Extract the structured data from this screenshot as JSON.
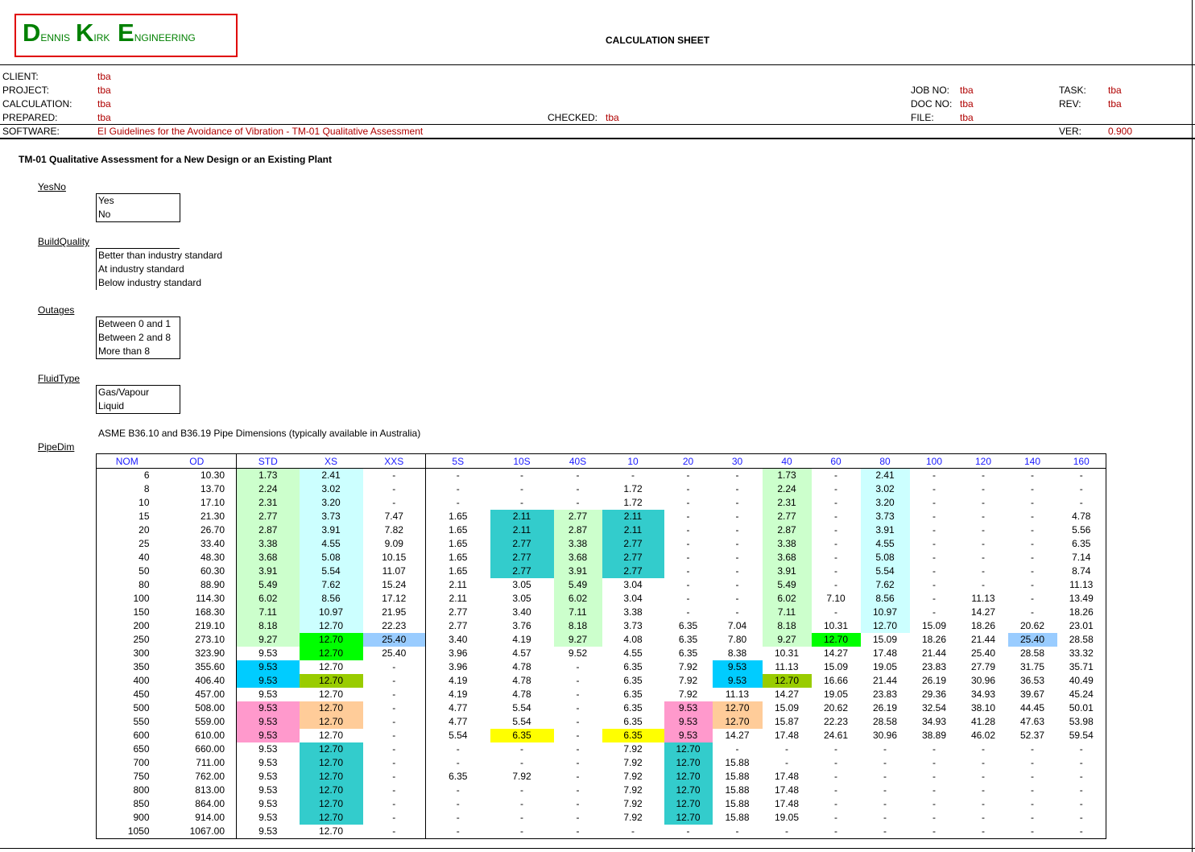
{
  "logo": {
    "d_big": "D",
    "d_rest": "ENNIS",
    "k_big": "K",
    "k_rest": "IRK",
    "e_big": "E",
    "e_rest": "NGINEERING"
  },
  "title": "CALCULATION SHEET",
  "header": {
    "client_label": "CLIENT:",
    "client": "tba",
    "project_label": "PROJECT:",
    "project": "tba",
    "calculation_label": "CALCULATION:",
    "calculation": "tba",
    "prepared_label": "PREPARED:",
    "prepared": "tba",
    "software_label": "SOFTWARE:",
    "software": "EI Guidelines for the Avoidance of Vibration - TM-01 Qualitative Assessment",
    "checked_label": "CHECKED:",
    "checked": "tba",
    "jobno_label": "JOB NO:",
    "jobno": "tba",
    "docno_label": "DOC NO:",
    "docno": "tba",
    "file_label": "FILE:",
    "file": "tba",
    "task_label": "TASK:",
    "task": "tba",
    "rev_label": "REV:",
    "rev": "tba",
    "ver_label": "VER:",
    "ver": "0.900"
  },
  "section_title": "TM-01 Qualitative Assessment for a New Design or an Existing Plant",
  "lists": {
    "yesno": {
      "name": "YesNo",
      "items": [
        "Yes",
        "No"
      ]
    },
    "buildquality": {
      "name": "BuildQuality",
      "items": [
        "Better than industry standard",
        "At industry standard",
        "Below industry standard"
      ]
    },
    "outages": {
      "name": "Outages",
      "items": [
        "Between 0 and 1",
        "Between 2 and 8",
        "More than 8"
      ]
    },
    "fluidtype": {
      "name": "FluidType",
      "items": [
        "Gas/Vapour",
        "Liquid"
      ]
    }
  },
  "pipedim": {
    "name": "PipeDim",
    "caption": "ASME B36.10 and B36.19 Pipe Dimensions (typically available in Australia)",
    "columns": [
      "NOM",
      "OD",
      "STD",
      "XS",
      "XXS",
      "5S",
      "10S",
      "40S",
      "10",
      "20",
      "30",
      "40",
      "60",
      "80",
      "100",
      "120",
      "140",
      "160"
    ],
    "rows": [
      [
        "6",
        "10.30",
        "1.73",
        "2.41",
        "-",
        "-",
        "-",
        "-",
        "-",
        "-",
        "-",
        "1.73",
        "-",
        "2.41",
        "-",
        "-",
        "-",
        "-"
      ],
      [
        "8",
        "13.70",
        "2.24",
        "3.02",
        "-",
        "-",
        "-",
        "-",
        "1.72",
        "-",
        "-",
        "2.24",
        "-",
        "3.02",
        "-",
        "-",
        "-",
        "-"
      ],
      [
        "10",
        "17.10",
        "2.31",
        "3.20",
        "-",
        "-",
        "-",
        "-",
        "1.72",
        "-",
        "-",
        "2.31",
        "-",
        "3.20",
        "-",
        "-",
        "-",
        "-"
      ],
      [
        "15",
        "21.30",
        "2.77",
        "3.73",
        "7.47",
        "1.65",
        "2.11",
        "2.77",
        "2.11",
        "-",
        "-",
        "2.77",
        "-",
        "3.73",
        "-",
        "-",
        "-",
        "4.78"
      ],
      [
        "20",
        "26.70",
        "2.87",
        "3.91",
        "7.82",
        "1.65",
        "2.11",
        "2.87",
        "2.11",
        "-",
        "-",
        "2.87",
        "-",
        "3.91",
        "-",
        "-",
        "-",
        "5.56"
      ],
      [
        "25",
        "33.40",
        "3.38",
        "4.55",
        "9.09",
        "1.65",
        "2.77",
        "3.38",
        "2.77",
        "-",
        "-",
        "3.38",
        "-",
        "4.55",
        "-",
        "-",
        "-",
        "6.35"
      ],
      [
        "40",
        "48.30",
        "3.68",
        "5.08",
        "10.15",
        "1.65",
        "2.77",
        "3.68",
        "2.77",
        "-",
        "-",
        "3.68",
        "-",
        "5.08",
        "-",
        "-",
        "-",
        "7.14"
      ],
      [
        "50",
        "60.30",
        "3.91",
        "5.54",
        "11.07",
        "1.65",
        "2.77",
        "3.91",
        "2.77",
        "-",
        "-",
        "3.91",
        "-",
        "5.54",
        "-",
        "-",
        "-",
        "8.74"
      ],
      [
        "80",
        "88.90",
        "5.49",
        "7.62",
        "15.24",
        "2.11",
        "3.05",
        "5.49",
        "3.04",
        "-",
        "-",
        "5.49",
        "-",
        "7.62",
        "-",
        "-",
        "-",
        "11.13"
      ],
      [
        "100",
        "114.30",
        "6.02",
        "8.56",
        "17.12",
        "2.11",
        "3.05",
        "6.02",
        "3.04",
        "-",
        "-",
        "6.02",
        "7.10",
        "8.56",
        "-",
        "11.13",
        "-",
        "13.49"
      ],
      [
        "150",
        "168.30",
        "7.11",
        "10.97",
        "21.95",
        "2.77",
        "3.40",
        "7.11",
        "3.38",
        "-",
        "-",
        "7.11",
        "-",
        "10.97",
        "-",
        "14.27",
        "-",
        "18.26"
      ],
      [
        "200",
        "219.10",
        "8.18",
        "12.70",
        "22.23",
        "2.77",
        "3.76",
        "8.18",
        "3.73",
        "6.35",
        "7.04",
        "8.18",
        "10.31",
        "12.70",
        "15.09",
        "18.26",
        "20.62",
        "23.01"
      ],
      [
        "250",
        "273.10",
        "9.27",
        "12.70",
        "25.40",
        "3.40",
        "4.19",
        "9.27",
        "4.08",
        "6.35",
        "7.80",
        "9.27",
        "12.70",
        "15.09",
        "18.26",
        "21.44",
        "25.40",
        "28.58"
      ],
      [
        "300",
        "323.90",
        "9.53",
        "12.70",
        "25.40",
        "3.96",
        "4.57",
        "9.52",
        "4.55",
        "6.35",
        "8.38",
        "10.31",
        "14.27",
        "17.48",
        "21.44",
        "25.40",
        "28.58",
        "33.32"
      ],
      [
        "350",
        "355.60",
        "9.53",
        "12.70",
        "-",
        "3.96",
        "4.78",
        "-",
        "6.35",
        "7.92",
        "9.53",
        "11.13",
        "15.09",
        "19.05",
        "23.83",
        "27.79",
        "31.75",
        "35.71"
      ],
      [
        "400",
        "406.40",
        "9.53",
        "12.70",
        "-",
        "4.19",
        "4.78",
        "-",
        "6.35",
        "7.92",
        "9.53",
        "12.70",
        "16.66",
        "21.44",
        "26.19",
        "30.96",
        "36.53",
        "40.49"
      ],
      [
        "450",
        "457.00",
        "9.53",
        "12.70",
        "-",
        "4.19",
        "4.78",
        "-",
        "6.35",
        "7.92",
        "11.13",
        "14.27",
        "19.05",
        "23.83",
        "29.36",
        "34.93",
        "39.67",
        "45.24"
      ],
      [
        "500",
        "508.00",
        "9.53",
        "12.70",
        "-",
        "4.77",
        "5.54",
        "-",
        "6.35",
        "9.53",
        "12.70",
        "15.09",
        "20.62",
        "26.19",
        "32.54",
        "38.10",
        "44.45",
        "50.01"
      ],
      [
        "550",
        "559.00",
        "9.53",
        "12.70",
        "-",
        "4.77",
        "5.54",
        "-",
        "6.35",
        "9.53",
        "12.70",
        "15.87",
        "22.23",
        "28.58",
        "34.93",
        "41.28",
        "47.63",
        "53.98"
      ],
      [
        "600",
        "610.00",
        "9.53",
        "12.70",
        "-",
        "5.54",
        "6.35",
        "-",
        "6.35",
        "9.53",
        "14.27",
        "17.48",
        "24.61",
        "30.96",
        "38.89",
        "46.02",
        "52.37",
        "59.54"
      ],
      [
        "650",
        "660.00",
        "9.53",
        "12.70",
        "-",
        "-",
        "-",
        "-",
        "7.92",
        "12.70",
        "-",
        "-",
        "-",
        "-",
        "-",
        "-",
        "-",
        "-"
      ],
      [
        "700",
        "711.00",
        "9.53",
        "12.70",
        "-",
        "-",
        "-",
        "-",
        "7.92",
        "12.70",
        "15.88",
        "-",
        "-",
        "-",
        "-",
        "-",
        "-",
        "-"
      ],
      [
        "750",
        "762.00",
        "9.53",
        "12.70",
        "-",
        "6.35",
        "7.92",
        "-",
        "7.92",
        "12.70",
        "15.88",
        "17.48",
        "-",
        "-",
        "-",
        "-",
        "-",
        "-"
      ],
      [
        "800",
        "813.00",
        "9.53",
        "12.70",
        "-",
        "-",
        "-",
        "-",
        "7.92",
        "12.70",
        "15.88",
        "17.48",
        "-",
        "-",
        "-",
        "-",
        "-",
        "-"
      ],
      [
        "850",
        "864.00",
        "9.53",
        "12.70",
        "-",
        "-",
        "-",
        "-",
        "7.92",
        "12.70",
        "15.88",
        "17.48",
        "-",
        "-",
        "-",
        "-",
        "-",
        "-"
      ],
      [
        "900",
        "914.00",
        "9.53",
        "12.70",
        "-",
        "-",
        "-",
        "-",
        "7.92",
        "12.70",
        "15.88",
        "19.05",
        "-",
        "-",
        "-",
        "-",
        "-",
        "-"
      ],
      [
        "1050",
        "1067.00",
        "9.53",
        "12.70",
        "-",
        "-",
        "-",
        "-",
        "-",
        "-",
        "-",
        "-",
        "-",
        "-",
        "-",
        "-",
        "-",
        "-"
      ]
    ]
  },
  "colors": {
    "logo_green": "#008000",
    "logo_border": "#e00000",
    "value_red": "#b00000",
    "header_blue": "#1a1aff",
    "light_green": "#ccffcc",
    "light_cyan": "#ccffff",
    "teal": "#33cccc",
    "bright_green": "#00ff00",
    "sky_blue": "#99ccff",
    "cyan": "#00ccff",
    "olive_green": "#99cc00",
    "pink": "#ff99cc",
    "tan": "#ffcc99",
    "yellow": "#ffff00"
  }
}
